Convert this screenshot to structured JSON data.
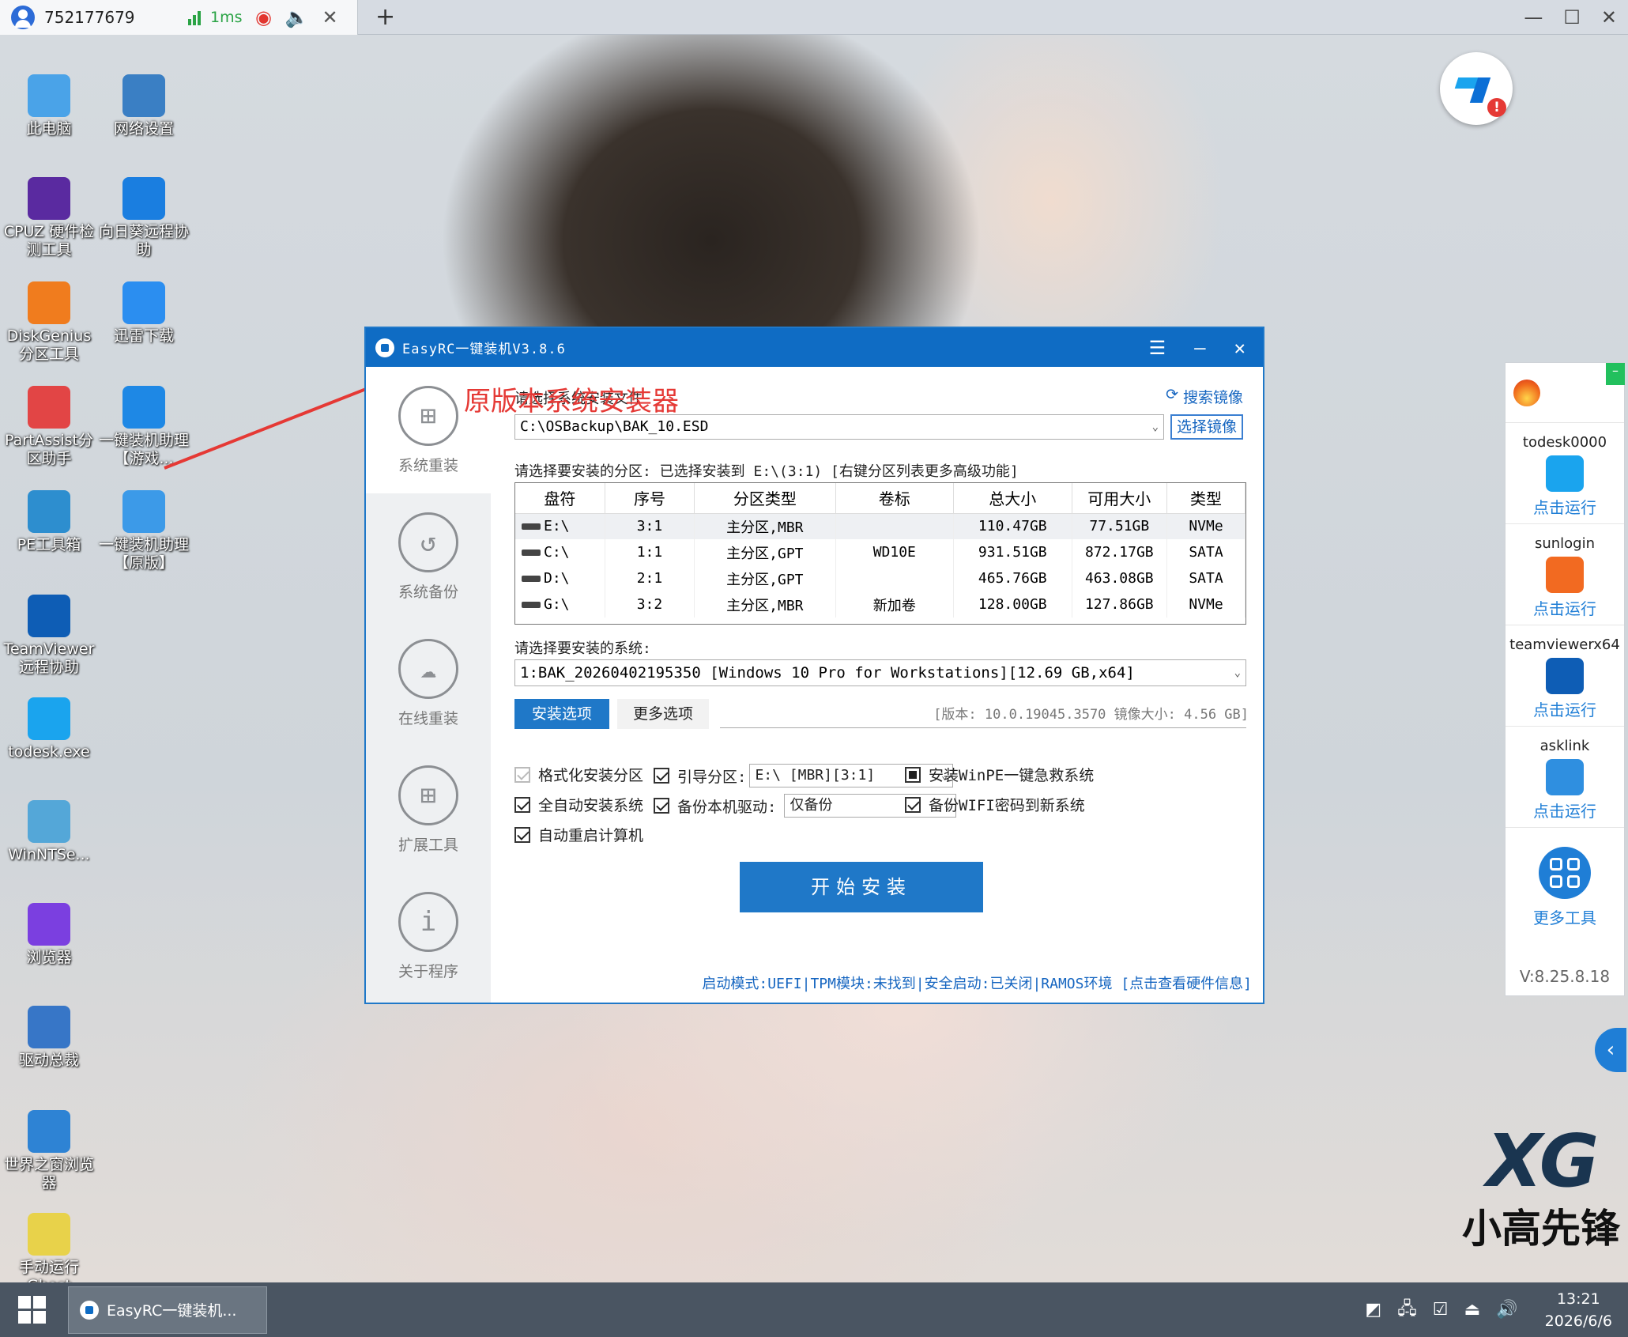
{
  "remote": {
    "session_id": "752177679",
    "latency": "1ms",
    "add_tab": "+"
  },
  "window_controls": [
    "—",
    "☐",
    "✕"
  ],
  "desktop_icons": [
    {
      "label": "此电脑",
      "icon": "computer-icon",
      "color": "#4aa3e8"
    },
    {
      "label": "网络设置",
      "icon": "network-icon",
      "color": "#3a7fc4"
    },
    {
      "label": "CPUZ 硬件检测工具",
      "icon": "cpuz-icon",
      "color": "#5a2aa0"
    },
    {
      "label": "向日葵远程协助",
      "icon": "sunlogin-icon",
      "color": "#1a7ee0"
    },
    {
      "label": "DiskGenius 分区工具",
      "icon": "diskgenius-icon",
      "color": "#f07c1e"
    },
    {
      "label": "迅雷下载",
      "icon": "thunder-icon",
      "color": "#2b8ef0"
    },
    {
      "label": "PartAssist分区助手",
      "icon": "partassist-icon",
      "color": "#e24545"
    },
    {
      "label": "一键装机助理【游戏...",
      "icon": "installer-icon",
      "color": "#1e88e5"
    },
    {
      "label": "PE工具箱",
      "icon": "pe-toolbox-icon",
      "color": "#2d8ecf"
    },
    {
      "label": "一键装机助理【原版】",
      "icon": "installer-original-icon",
      "color": "#3c9ae8"
    },
    {
      "label": "TeamViewer远程协助",
      "icon": "teamviewer-icon",
      "color": "#0e5db5"
    },
    {
      "label": "todesk.exe",
      "icon": "todesk-icon",
      "color": "#1aa4ee"
    },
    {
      "label": "WinNTSe...",
      "icon": "winntsetup-icon",
      "color": "#54a7d8"
    },
    {
      "label": "浏览器",
      "icon": "browser-icon",
      "color": "#7b3fe0"
    },
    {
      "label": "驱动总裁",
      "icon": "driver-icon",
      "color": "#3776c7"
    },
    {
      "label": "世界之窗浏览器",
      "icon": "theworld-icon",
      "color": "#2e83d4"
    },
    {
      "label": "手动运行Ghost",
      "icon": "ghost-icon",
      "color": "#e8d24a"
    }
  ],
  "side_panel": {
    "items": [
      {
        "name": "todesk0000",
        "run": "点击运行",
        "icon": "todesk-icon",
        "color": "#1aa4ee"
      },
      {
        "name": "sunlogin",
        "run": "点击运行",
        "icon": "sunlogin-icon",
        "color": "#f26a21"
      },
      {
        "name": "teamviewerx64",
        "run": "点击运行",
        "icon": "teamviewer-icon",
        "color": "#0e5db5"
      },
      {
        "name": "asklink",
        "run": "点击运行",
        "icon": "asklink-icon",
        "color": "#2f8fe0"
      }
    ],
    "more_tools": "更多工具",
    "version": "V:8.25.8.18"
  },
  "watermark": {
    "xg": "XG",
    "text": "小高先锋"
  },
  "annotation": "原版本系统安装器",
  "app": {
    "title": "EasyRC一键装机V3.8.6",
    "nav": [
      {
        "label": "系统重装",
        "icon": "windows-icon",
        "glyph": "⊞"
      },
      {
        "label": "系统备份",
        "icon": "backup-icon",
        "glyph": "↺"
      },
      {
        "label": "在线重装",
        "icon": "cloud-icon",
        "glyph": "☁"
      },
      {
        "label": "扩展工具",
        "icon": "apps-icon",
        "glyph": "⊞"
      },
      {
        "label": "关于程序",
        "icon": "info-icon",
        "glyph": "i"
      }
    ],
    "select_file_label": "请选择系统安装文件",
    "search_image": "搜索镜像",
    "image_path": "C:\\OSBackup\\BAK_10.ESD",
    "choose_image": "选择镜像",
    "partition_label": "请选择要安装的分区: 已选择安装到 E:\\(3:1) [右键分区列表更多高级功能]",
    "columns": [
      "盘符",
      "序号",
      "分区类型",
      "卷标",
      "总大小",
      "可用大小",
      "类型"
    ],
    "rows": [
      [
        "E:\\",
        "3:1",
        "主分区,MBR",
        "",
        "110.47GB",
        "77.51GB",
        "NVMe"
      ],
      [
        "C:\\",
        "1:1",
        "主分区,GPT",
        "WD10E",
        "931.51GB",
        "872.17GB",
        "SATA"
      ],
      [
        "D:\\",
        "2:1",
        "主分区,GPT",
        "",
        "465.76GB",
        "463.08GB",
        "SATA"
      ],
      [
        "G:\\",
        "3:2",
        "主分区,MBR",
        "新加卷",
        "128.00GB",
        "127.86GB",
        "NVMe"
      ]
    ],
    "system_label": "请选择要安装的系统:",
    "system_value": "1:BAK_20260402195350 [Windows 10 Pro for Workstations][12.69 GB,x64]",
    "tabs": [
      "安装选项",
      "更多选项"
    ],
    "version_info": "[版本: 10.0.19045.3570 镜像大小: 4.56 GB]",
    "options": {
      "format": "格式化安装分区",
      "auto_install": "全自动安装系统",
      "auto_reboot": "自动重启计算机",
      "boot_label": "引导分区:",
      "boot_value": "E:\\ [MBR][3:1]",
      "driver_label": "备份本机驱动:",
      "driver_value": "仅备份",
      "winpe": "安装WinPE一键急救系统",
      "wifi": "备份WIFI密码到新系统"
    },
    "start": "开始安装",
    "status": "启动模式:UEFI|TPM模块:未找到|安全启动:已关闭|RAMOS环境 [点击查看硬件信息]"
  },
  "taskbar": {
    "task": "EasyRC一键装机...",
    "time": "13:21",
    "date": "2026/6/6"
  }
}
